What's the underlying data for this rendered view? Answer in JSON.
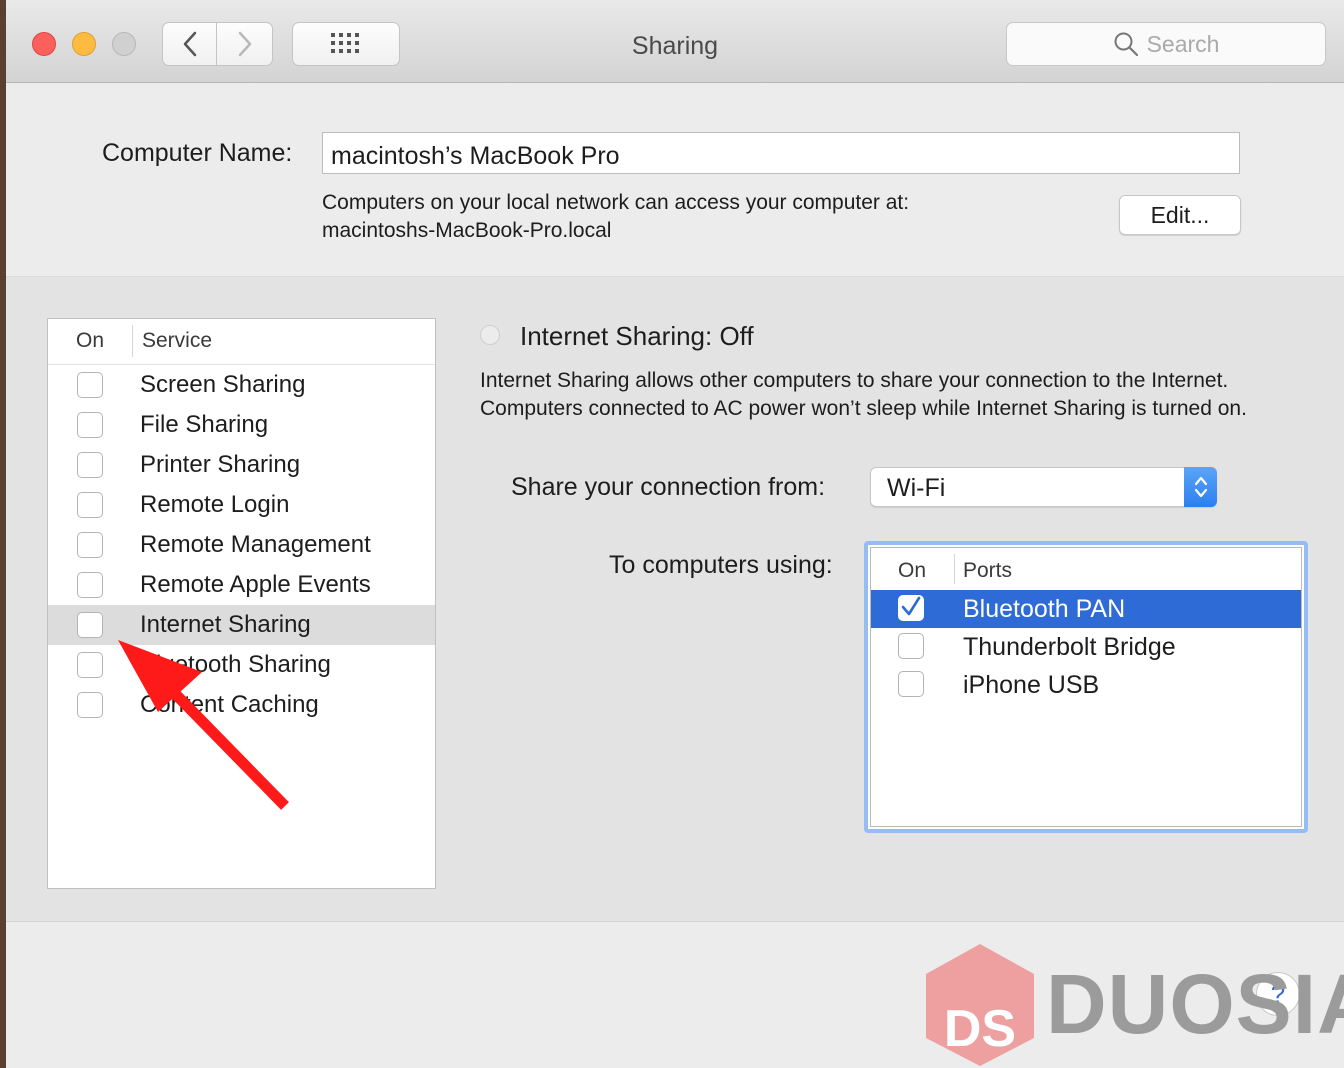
{
  "window": {
    "title": "Sharing",
    "search_placeholder": "Search"
  },
  "computer_name": {
    "label": "Computer Name:",
    "value": "macintosh’s MacBook Pro",
    "network_line1": "Computers on your local network can access your computer at:",
    "network_line2": "macintoshs-MacBook-Pro.local",
    "edit_button": "Edit..."
  },
  "services": {
    "col_on": "On",
    "col_service": "Service",
    "items": [
      {
        "label": "Screen Sharing",
        "checked": false,
        "selected": false
      },
      {
        "label": "File Sharing",
        "checked": false,
        "selected": false
      },
      {
        "label": "Printer Sharing",
        "checked": false,
        "selected": false
      },
      {
        "label": "Remote Login",
        "checked": false,
        "selected": false
      },
      {
        "label": "Remote Management",
        "checked": false,
        "selected": false
      },
      {
        "label": "Remote Apple Events",
        "checked": false,
        "selected": false
      },
      {
        "label": "Internet Sharing",
        "checked": false,
        "selected": true
      },
      {
        "label": "Bluetooth Sharing",
        "checked": false,
        "selected": false
      },
      {
        "label": "Content Caching",
        "checked": false,
        "selected": false
      }
    ]
  },
  "internet_sharing": {
    "status": "Internet Sharing: Off",
    "description": "Internet Sharing allows other computers to share your connection to the Internet. Computers connected to AC power won’t sleep while Internet Sharing is turned on.",
    "share_from_label": "Share your connection from:",
    "share_from_value": "Wi-Fi",
    "to_label": "To computers using:",
    "ports_col_on": "On",
    "ports_col_ports": "Ports",
    "ports": [
      {
        "label": "Bluetooth PAN",
        "checked": true,
        "selected": true
      },
      {
        "label": "Thunderbolt Bridge",
        "checked": false,
        "selected": false
      },
      {
        "label": "iPhone USB",
        "checked": false,
        "selected": false
      }
    ]
  },
  "help_label": "?",
  "watermark": {
    "text": "DUOSIA",
    "logo_text": "DS"
  },
  "colors": {
    "accent": "#2e6bd6",
    "annotation_arrow": "#ff1a1a"
  }
}
